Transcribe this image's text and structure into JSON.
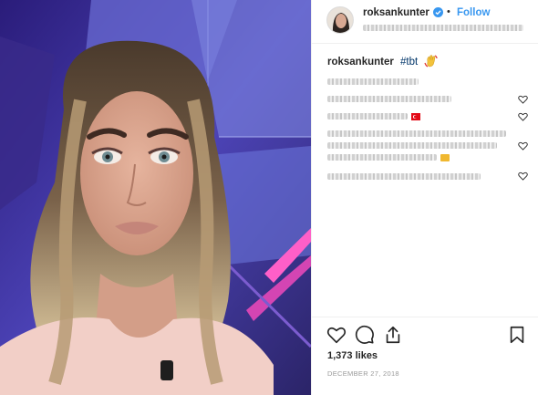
{
  "header": {
    "username": "roksankunter",
    "separator": "•",
    "follow_label": "Follow"
  },
  "caption": {
    "username": "roksankunter",
    "hashtag": "#tbt"
  },
  "stats": {
    "likes": "1,373 likes",
    "date": "DECEMBER 27, 2018"
  },
  "icons": [
    "verified-badge-icon",
    "like-icon",
    "comment-icon",
    "share-icon",
    "bookmark-icon",
    "small-heart-icon"
  ],
  "colors": {
    "follow": "#3897f0",
    "hashtag": "#003569",
    "verified": "#3897f0"
  }
}
